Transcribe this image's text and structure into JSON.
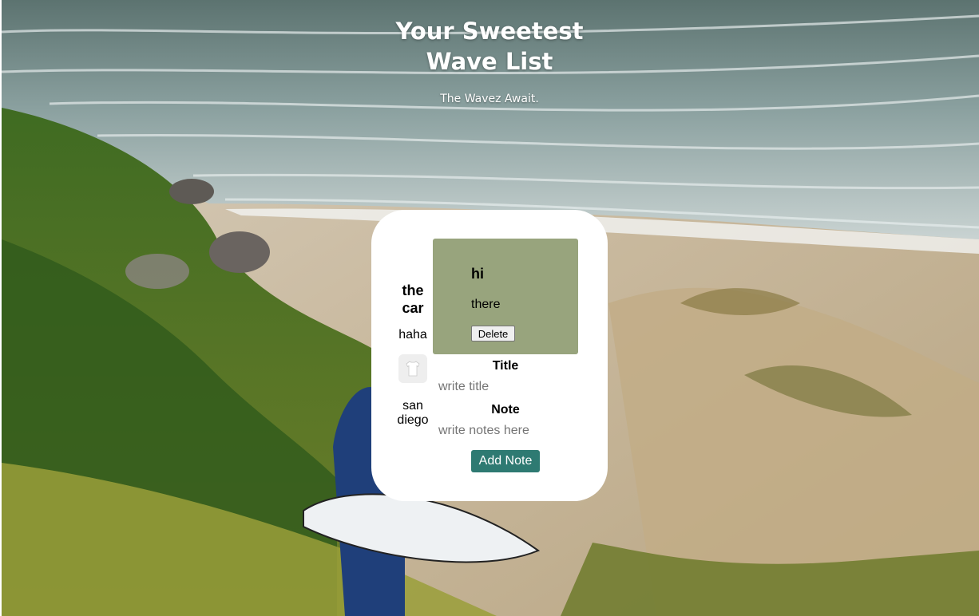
{
  "header": {
    "title_line1": "Your Sweetest",
    "title_line2": "Wave List",
    "subtitle": "The Wavez Await."
  },
  "notes": [
    {
      "title": "the car",
      "body": "haha",
      "image_icon": "tshirt-icon",
      "place": "san diego"
    },
    {
      "title": "hi",
      "body": "there",
      "delete_label": "Delete",
      "card_color": "#98a47d"
    }
  ],
  "form": {
    "title_label": "Title",
    "title_placeholder": "write title",
    "note_label": "Note",
    "note_placeholder": "write notes here",
    "submit_label": "Add Note",
    "submit_color": "#2e7a72"
  }
}
